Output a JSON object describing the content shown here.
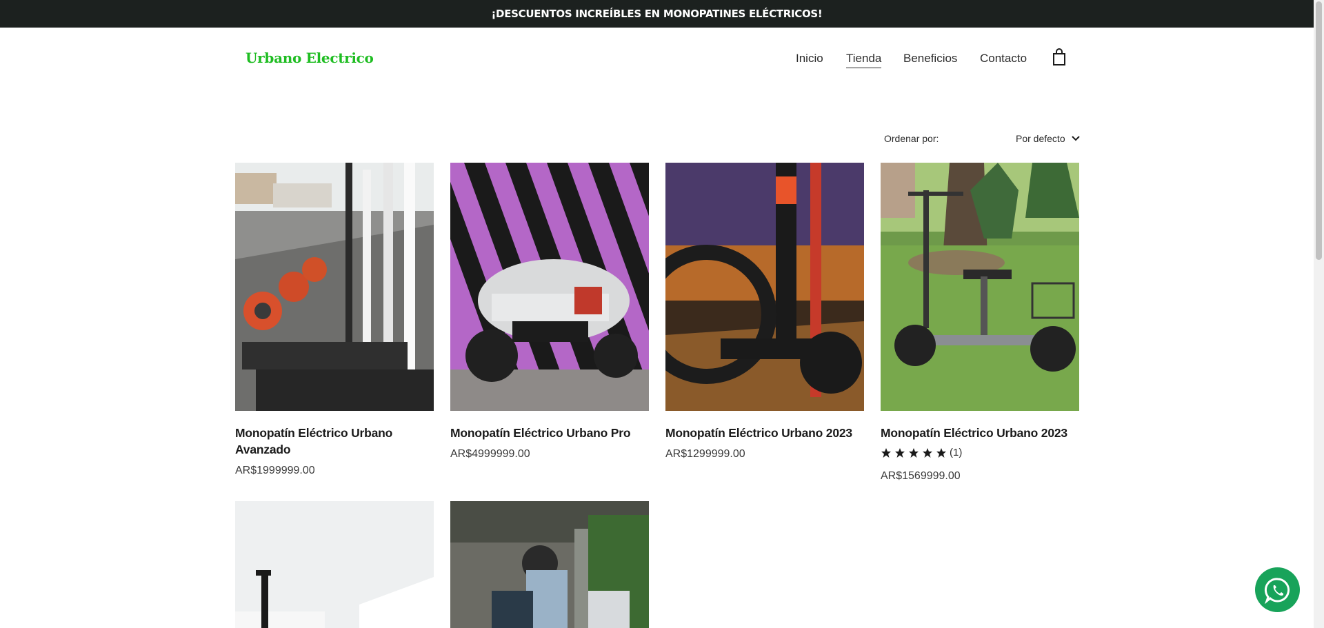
{
  "announcement": "¡DESCUENTOS INCREÍBLES EN MONOPATINES ELÉCTRICOS!",
  "brand": {
    "logo_text": "Urbano Electrico",
    "accent_color": "#1fbd22"
  },
  "nav": {
    "items": [
      {
        "label": "Inicio",
        "active": false
      },
      {
        "label": "Tienda",
        "active": true
      },
      {
        "label": "Beneficios",
        "active": false
      },
      {
        "label": "Contacto",
        "active": false
      }
    ],
    "cart_icon": "shopping-bag-icon"
  },
  "sort": {
    "label": "Ordenar por:",
    "selected": "Por defecto"
  },
  "products": [
    {
      "title": "Monopatín Eléctrico Urbano Avanzado",
      "price": "AR$1999999.00",
      "image": "row-of-scooters-photo"
    },
    {
      "title": "Monopatín Eléctrico Urbano Pro",
      "price": "AR$4999999.00",
      "image": "moped-striped-wall-photo"
    },
    {
      "title": "Monopatín Eléctrico Urbano 2023",
      "price": "AR$1299999.00",
      "image": "scooter-night-city-photo"
    },
    {
      "title": "Monopatín Eléctrico Urbano 2023",
      "price": "AR$1569999.00",
      "image": "seated-scooter-park-photo",
      "rating": 5,
      "rating_count": "(1)"
    },
    {
      "title": "",
      "price": "",
      "image": "scooter-white-tent-photo"
    },
    {
      "title": "",
      "price": "",
      "image": "rider-helmet-moped-photo"
    }
  ],
  "whatsapp": {
    "icon": "whatsapp-icon",
    "color": "#18a35a"
  }
}
